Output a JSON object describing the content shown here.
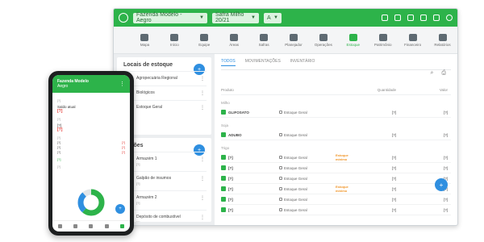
{
  "window": {
    "farm_select": "Fazenda Modelo - Aegro",
    "season_select": "Safra Milho 20/21",
    "year_select": "A",
    "accent_color": "#2db34a"
  },
  "nav": [
    {
      "label": "Mapa",
      "icon": "globe-icon"
    },
    {
      "label": "Início",
      "icon": "home-icon"
    },
    {
      "label": "Equipe",
      "icon": "people-icon"
    },
    {
      "label": "Áreas",
      "icon": "map-icon"
    },
    {
      "label": "Safras",
      "icon": "plant-icon"
    },
    {
      "label": "Planejador",
      "icon": "planner-icon"
    },
    {
      "label": "Operações",
      "icon": "tractor-icon"
    },
    {
      "label": "Estoque",
      "icon": "inventory-icon"
    },
    {
      "label": "Patrimônio",
      "icon": "asset-icon"
    },
    {
      "label": "Financeiro",
      "icon": "finance-icon"
    },
    {
      "label": "Relatórios",
      "icon": "reports-icon"
    }
  ],
  "left": {
    "locais_title": "Locais de estoque",
    "locais": [
      {
        "name": "Agropecuária Regional"
      },
      {
        "name": "Biológicos"
      },
      {
        "name": "Estoque Geral"
      }
    ],
    "sections_title": "Seções",
    "sections": [
      {
        "name": "Armazém 1",
        "sub": "[?]"
      },
      {
        "name": "Galpão de insumos",
        "sub": "[?]"
      },
      {
        "name": "Armazém 2",
        "sub": "[?]"
      },
      {
        "name": "Depósito de combustível",
        "sub": "[?]"
      },
      {
        "name": "[?]",
        "sub": "[?]"
      }
    ]
  },
  "main": {
    "tabs": [
      "TODOS",
      "MOVIMENTAÇÕES",
      "INVENTÁRIO"
    ],
    "col_product": "Produto",
    "col_qty": "Quantidade",
    "col_value": "Valor",
    "groups": [
      {
        "name": "Milho",
        "rows": [
          {
            "name": "GLIFOSATO",
            "loc": "Estoque Geral",
            "tag": "",
            "qty": "[?]",
            "val": "[?]"
          }
        ]
      },
      {
        "name": "Soja",
        "rows": [
          {
            "name": "ADUBO",
            "loc": "Estoque Geral",
            "tag": "",
            "qty": "[?]",
            "val": "[?]"
          }
        ]
      },
      {
        "name": "Trigo",
        "rows": [
          {
            "name": "[?]",
            "loc": "Estoque Geral",
            "tag": "Estoque mínimo",
            "qty": "[?]",
            "val": "[?]"
          },
          {
            "name": "[?]",
            "loc": "Estoque Geral",
            "tag": "",
            "qty": "[?]",
            "val": "[?]"
          },
          {
            "name": "[?]",
            "loc": "Estoque Geral",
            "tag": "",
            "qty": "[?]",
            "val": "[?]"
          },
          {
            "name": "[?]",
            "loc": "Estoque Geral",
            "tag": "Estoque mínimo",
            "qty": "[?]",
            "val": "[?]"
          },
          {
            "name": "[?]",
            "loc": "Estoque Geral",
            "tag": "",
            "qty": "[?]",
            "val": "[?]"
          },
          {
            "name": "[?]",
            "loc": "Estoque Geral",
            "tag": "",
            "qty": "[?]",
            "val": "[?]"
          }
        ]
      }
    ]
  },
  "phone": {
    "header_title": "Fazenda Modelo",
    "header_sub": "Aegro",
    "label1": "[?]",
    "item1": "Saldo atual",
    "value1": "[?]",
    "label2": "[?]",
    "item2": "[?]",
    "value2": "[?]",
    "label3": "[?]",
    "small_rows": [
      {
        "name": "[?]",
        "val": "[?]"
      },
      {
        "name": "[?]",
        "val": "[?]"
      },
      {
        "name": "[?]",
        "val": "[?]"
      }
    ],
    "link": "[?]",
    "label4": "[?]"
  }
}
